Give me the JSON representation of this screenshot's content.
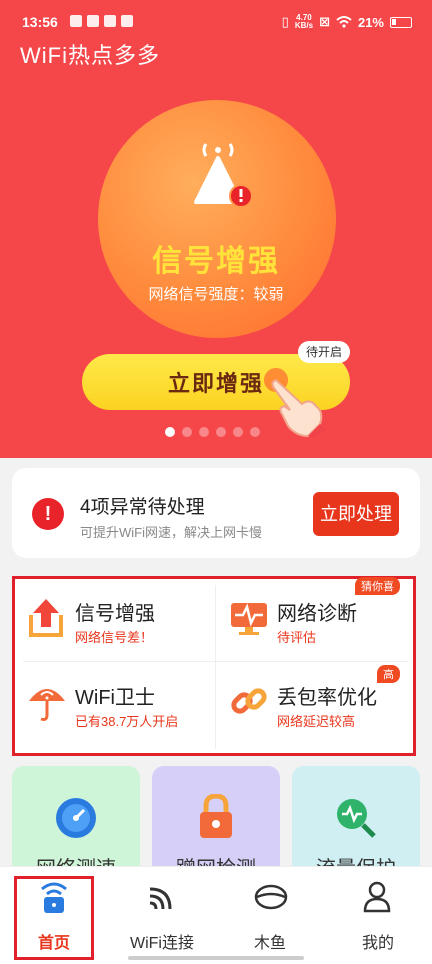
{
  "status_bar": {
    "time": "13:56",
    "speed": "4.70",
    "speed_unit": "KB/s",
    "battery": "21%"
  },
  "app": {
    "title": "WiFi热点多多"
  },
  "hero": {
    "title": "信号增强",
    "subtitle": "网络信号强度：较弱",
    "button_label": "立即增强",
    "pending_tag": "待开启",
    "carousel_dots": 6,
    "active_dot": 0
  },
  "alert": {
    "title": "4项异常待处理",
    "subtitle": "可提升WiFi网速，解决上网卡慢",
    "button_label": "立即处理",
    "icon": "exclamation-icon"
  },
  "features": [
    {
      "title": "信号增强",
      "subtitle": "网络信号差！",
      "subtitle_color": "#e8361c",
      "icon": "signal-boost-icon"
    },
    {
      "title": "网络诊断",
      "subtitle": "待评估",
      "subtitle_color": "#e8361c",
      "icon": "network-diagnose-icon",
      "badge": "猜你喜"
    },
    {
      "title": "WiFi卫士",
      "subtitle": "已有38.7万人开启",
      "subtitle_color": "#e8361c",
      "icon": "umbrella-shield-icon"
    },
    {
      "title": "丢包率优化",
      "subtitle": "网络延迟较高",
      "subtitle_color": "#e8361c",
      "icon": "chain-link-icon",
      "badge": "高"
    }
  ],
  "tiles": [
    {
      "label": "网络测速",
      "color": "#cff5d8",
      "icon": "speedometer-icon"
    },
    {
      "label": "蹭网检测",
      "color": "#d6cff7",
      "icon": "lock-icon"
    },
    {
      "label": "流量保护",
      "color": "#cfeff2",
      "icon": "magnifier-pulse-icon"
    }
  ],
  "tabbar": [
    {
      "label": "首页",
      "icon": "home-wifi-icon",
      "active": true
    },
    {
      "label": "WiFi连接",
      "icon": "wifi-icon",
      "active": false
    },
    {
      "label": "木鱼",
      "icon": "wooden-fish-icon",
      "active": false
    },
    {
      "label": "我的",
      "icon": "person-icon",
      "active": false
    }
  ],
  "colors": {
    "hero_bg": "#f5474a",
    "accent": "#e8361c",
    "button_yellow": "#fbd321"
  }
}
